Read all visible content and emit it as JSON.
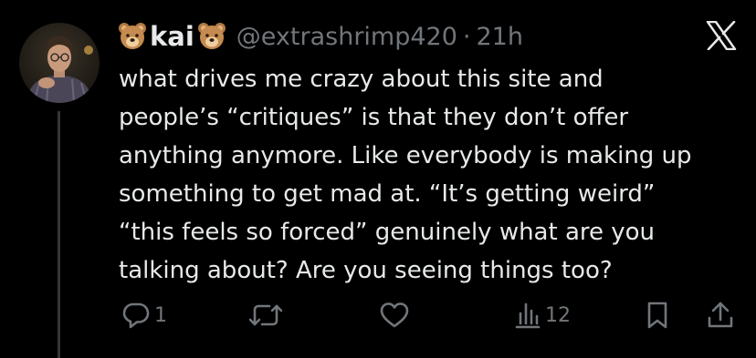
{
  "tweet": {
    "author": {
      "display_name": "kai",
      "name_prefix_emoji": "bear-face-emoji",
      "name_suffix_emoji": "bear-face-emoji",
      "handle": "@extrashrimp420",
      "avatar_icon": "profile-photo"
    },
    "separator": "·",
    "timestamp": "21h",
    "platform_logo": "x-logo-icon",
    "text": "what drives me crazy about this site and\npeople’s “critiques” is that they don’t offer\nanything anymore. Like everybody is making up\nsomething to get mad at. “It’s getting weird”\n“this feels so forced” genuinely what are you\ntalking about? Are you seeing things too?",
    "actions": {
      "reply": {
        "icon": "reply-icon",
        "count": "1"
      },
      "repost": {
        "icon": "repost-icon",
        "count": ""
      },
      "like": {
        "icon": "heart-icon",
        "count": ""
      },
      "views": {
        "icon": "views-icon",
        "count": "12"
      },
      "bookmark": {
        "icon": "bookmark-icon"
      },
      "share": {
        "icon": "share-icon"
      }
    }
  },
  "colors": {
    "background": "#000000",
    "primary_text": "#e7e9ea",
    "secondary_text": "#71767b",
    "thread_line": "#333639"
  }
}
